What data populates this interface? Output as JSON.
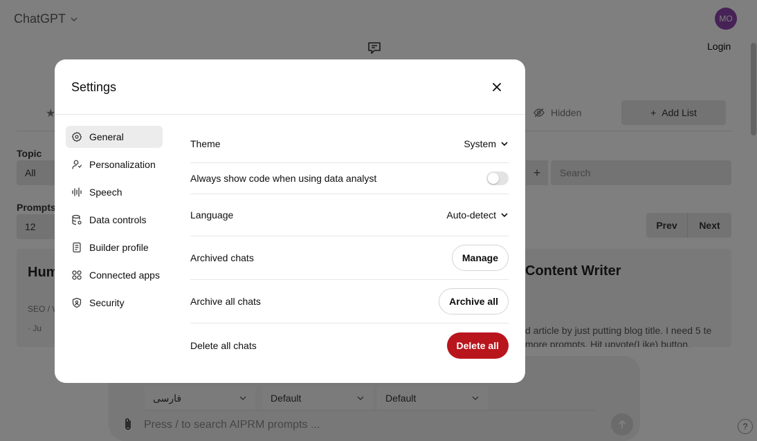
{
  "app": {
    "title": "ChatGPT",
    "avatar_initials": "MO",
    "login_label": "Login"
  },
  "background": {
    "hidden_tab_label": "Hidden",
    "add_list_label": "Add List",
    "topic_label": "Topic",
    "topic_value": "All",
    "search_placeholder": "Search",
    "prompts_label": "Prompts",
    "prompts_value": "12",
    "prev_label": "Prev",
    "next_label": "Next",
    "card_left": {
      "title": "Hum Opti",
      "meta": "SEO / W",
      "meta2": "· Ju"
    },
    "card_right": {
      "title": "Content Writer",
      "description": "d article by just putting blog title. I need 5 te more prompts. Hit upvote(Like) button."
    },
    "composer": {
      "language_value": "فارسی",
      "tone_value": "Default",
      "style_value": "Default",
      "placeholder": "Press / to search AIPRM prompts ..."
    },
    "help_label": "?"
  },
  "settings": {
    "title": "Settings",
    "nav": [
      {
        "label": "General",
        "icon": "gear-icon",
        "active": true
      },
      {
        "label": "Personalization",
        "icon": "person-icon"
      },
      {
        "label": "Speech",
        "icon": "waveform-icon"
      },
      {
        "label": "Data controls",
        "icon": "database-icon"
      },
      {
        "label": "Builder profile",
        "icon": "id-card-icon"
      },
      {
        "label": "Connected apps",
        "icon": "apps-grid-icon"
      },
      {
        "label": "Security",
        "icon": "shield-icon"
      }
    ],
    "rows": {
      "theme": {
        "label": "Theme",
        "value": "System"
      },
      "code": {
        "label": "Always show code when using data analyst",
        "enabled": false
      },
      "language": {
        "label": "Language",
        "value": "Auto-detect"
      },
      "archived": {
        "label": "Archived chats",
        "button": "Manage"
      },
      "archive_all": {
        "label": "Archive all chats",
        "button": "Archive all"
      },
      "delete_all": {
        "label": "Delete all chats",
        "button": "Delete all"
      }
    }
  },
  "colors": {
    "danger": "#b9151c",
    "avatar": "#8e44ad",
    "active_nav": "#ececec"
  }
}
